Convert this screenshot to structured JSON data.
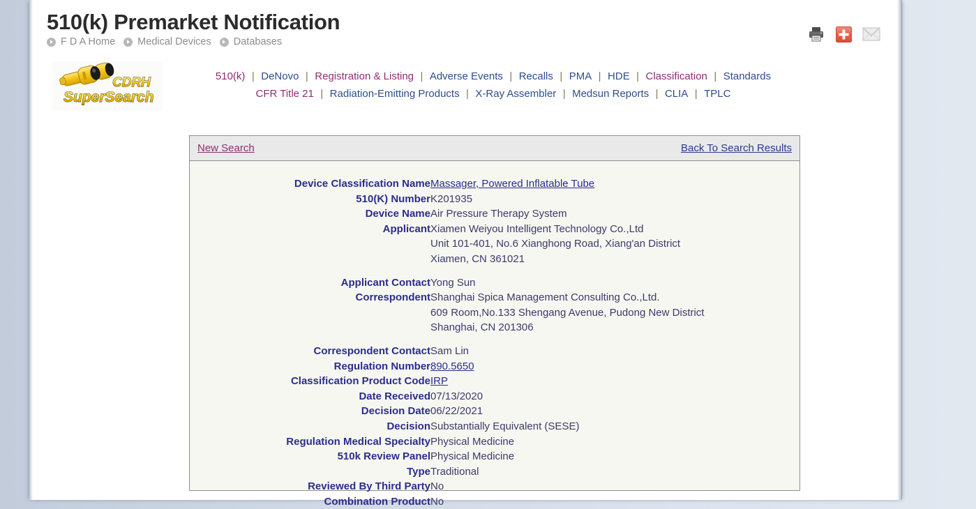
{
  "header": {
    "title": "510(k) Premarket Notification",
    "breadcrumb": [
      {
        "icon": "chevron-circle-icon",
        "label": "F D A Home"
      },
      {
        "icon": "chevron-circle-icon",
        "label": "Medical Devices"
      },
      {
        "icon": "chevron-circle-icon",
        "label": "Databases"
      }
    ],
    "tools": [
      {
        "name": "print-icon",
        "label": "Print"
      },
      {
        "name": "share-plus-icon",
        "label": "Share"
      },
      {
        "name": "email-icon",
        "label": "Email"
      }
    ]
  },
  "logo": {
    "name": "cdrh-supersearch-logo",
    "line1": "CDRH",
    "line2": "SuperSearch",
    "alt": "CDRH SuperSearch"
  },
  "nav": {
    "row1": [
      {
        "label": "510(k)",
        "state": "visited"
      },
      {
        "label": "DeNovo",
        "state": "default"
      },
      {
        "label": "Registration & Listing",
        "state": "visited"
      },
      {
        "label": "Adverse Events",
        "state": "default"
      },
      {
        "label": "Recalls",
        "state": "default"
      },
      {
        "label": "PMA",
        "state": "default"
      },
      {
        "label": "HDE",
        "state": "default"
      },
      {
        "label": "Classification",
        "state": "visited"
      },
      {
        "label": "Standards",
        "state": "default"
      }
    ],
    "row2": [
      {
        "label": "CFR Title 21",
        "state": "visited"
      },
      {
        "label": "Radiation-Emitting Products",
        "state": "default"
      },
      {
        "label": "X-Ray Assembler",
        "state": "default"
      },
      {
        "label": "Medsun Reports",
        "state": "default"
      },
      {
        "label": "CLIA",
        "state": "default"
      },
      {
        "label": "TPLC",
        "state": "default"
      }
    ],
    "separator": "|"
  },
  "results": {
    "new_search_label": "New Search",
    "back_label": "Back To Search Results",
    "rows": [
      {
        "label": "Device Classification Name",
        "value": "Massager, Powered Inflatable Tube",
        "link": true,
        "gap_after": false
      },
      {
        "label": "510(K) Number",
        "value": "K201935",
        "link": false,
        "gap_after": false
      },
      {
        "label": "Device Name",
        "value": "Air Pressure Therapy System",
        "link": false,
        "gap_after": false
      },
      {
        "label": "Applicant",
        "value": "Xiamen Weiyou Intelligent Technology Co.,Ltd\nUnit 101-401, No.6 Xianghong Road, Xiang'an District\nXiamen,  CN 361021",
        "link": false,
        "gap_after": true
      },
      {
        "label": "Applicant Contact",
        "value": "Yong Sun",
        "link": false,
        "gap_after": false
      },
      {
        "label": "Correspondent",
        "value": "Shanghai Spica Management Consulting Co.,Ltd.\n609 Room,No.133 Shengang Avenue, Pudong New District\nShanghai,  CN 201306",
        "link": false,
        "gap_after": true
      },
      {
        "label": "Correspondent Contact",
        "value": "Sam Lin",
        "link": false,
        "gap_after": false
      },
      {
        "label": "Regulation Number",
        "value": "890.5650",
        "link": true,
        "gap_after": false
      },
      {
        "label": "Classification Product Code",
        "value": "IRP",
        "link": true,
        "gap_after": false
      },
      {
        "label": "Date Received",
        "value": "07/13/2020",
        "link": false,
        "gap_after": false
      },
      {
        "label": "Decision Date",
        "value": "06/22/2021",
        "link": false,
        "gap_after": false
      },
      {
        "label": "Decision",
        "value": "Substantially Equivalent (SESE)",
        "link": false,
        "gap_after": false
      },
      {
        "label": "Regulation Medical Specialty",
        "value": "Physical Medicine",
        "link": false,
        "gap_after": false
      },
      {
        "label": "510k Review Panel",
        "value": "Physical Medicine",
        "link": false,
        "gap_after": false
      },
      {
        "label": "Type",
        "value": "Traditional",
        "link": false,
        "gap_after": false
      },
      {
        "label": "Reviewed By Third Party",
        "value": "No",
        "link": false,
        "gap_after": false
      },
      {
        "label": "Combination Product",
        "value": "No",
        "link": false,
        "gap_after": false
      }
    ]
  },
  "colors": {
    "label": "#2b2d8c",
    "value": "#3b3b6b",
    "link_blue": "#2e4d8c",
    "link_visited": "#8d2e73",
    "panel_bg": "#f6f7f0",
    "panel_head_bg": "#e9e9e9",
    "page_bg": "#ffffff",
    "desktop_bg": "#ccd5e2",
    "accent_red": "#e8614c"
  }
}
